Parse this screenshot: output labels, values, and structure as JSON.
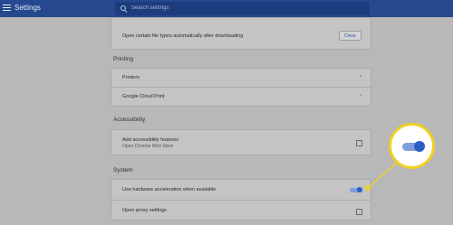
{
  "app": {
    "title": "Settings"
  },
  "search": {
    "placeholder": "Search settings",
    "value": ""
  },
  "downloads": {
    "auto_open_label": "Open certain file types automatically after downloading",
    "clear_label": "Clear"
  },
  "printing": {
    "title": "Printing",
    "items": [
      "Printers",
      "Google Cloud Print"
    ]
  },
  "accessibility": {
    "title": "Accessibility",
    "add_features_label": "Add accessibility features",
    "add_features_sub": "Open Chrome Web Store"
  },
  "system": {
    "title": "System",
    "hw_accel_label": "Use hardware acceleration when available",
    "hw_accel_enabled": true,
    "proxy_label": "Open proxy settings"
  },
  "colors": {
    "accent": "#2b5fc6",
    "header": "#25488f",
    "callout": "#f0d020"
  },
  "icons": [
    "menu-icon",
    "search-icon",
    "chevron-right-icon",
    "external-link-icon"
  ]
}
